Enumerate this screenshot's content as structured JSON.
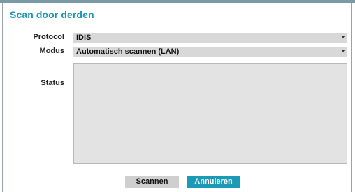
{
  "dialog": {
    "title": "Scan door derden"
  },
  "form": {
    "protocol": {
      "label": "Protocol",
      "value": "IDIS"
    },
    "modus": {
      "label": "Modus",
      "value": "Automatisch scannen (LAN)"
    },
    "status": {
      "label": "Status",
      "value": ""
    }
  },
  "buttons": {
    "scan_label": "Scannen",
    "cancel_label": "Annuleren"
  },
  "colors": {
    "accent": "#1b95b4",
    "primary_button": "#1b9ab7",
    "secondary_button": "#cfcfcf",
    "field_background": "#d8d8d8"
  }
}
